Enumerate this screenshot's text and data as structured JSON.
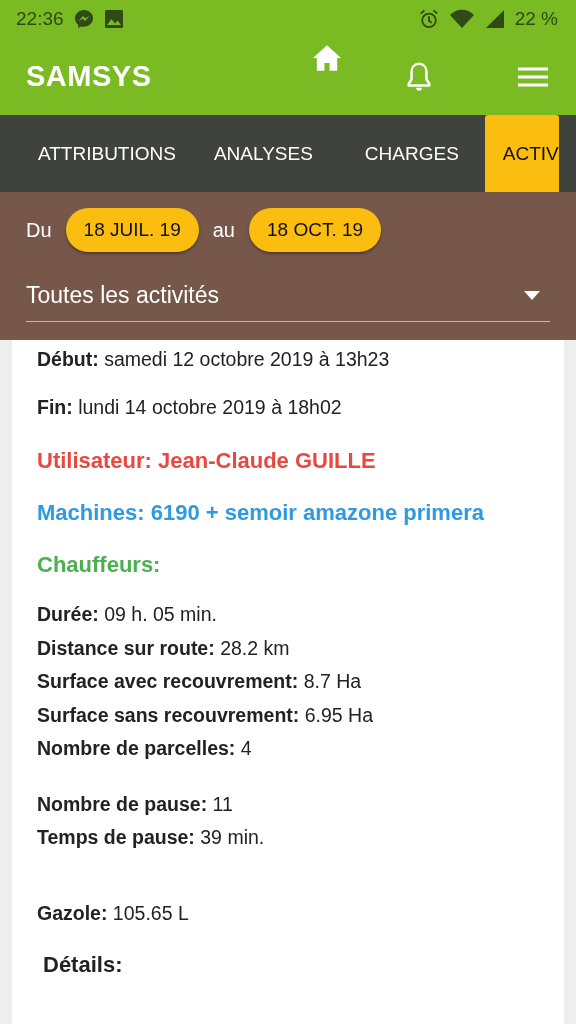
{
  "status_bar": {
    "time": "22:36",
    "battery": "22 %"
  },
  "app_bar": {
    "title": "SAMSYS"
  },
  "tabs": [
    {
      "label": "ATTRIBUTIONS",
      "selected": false
    },
    {
      "label": "ANALYSES",
      "selected": false
    },
    {
      "label": "CHARGES",
      "selected": false
    },
    {
      "label": "ACTIV",
      "selected": true
    }
  ],
  "filter": {
    "from_label": "Du",
    "from_date": "18 JUIL. 19",
    "to_label": "au",
    "to_date": "18 OCT. 19",
    "activity": "Toutes les activités"
  },
  "details": [
    {
      "kind": "line",
      "label": "Début:",
      "value": "samedi 12 octobre 2019 à 13h23"
    },
    {
      "kind": "line",
      "label": "Fin:",
      "value": "lundi 14 octobre 2019 à 18h02"
    },
    {
      "kind": "heading",
      "text": "Utilisateur: Jean-Claude GUILLE",
      "color": "#e8483e"
    },
    {
      "kind": "heading",
      "text": "Machines: 6190 + semoir amazone primera",
      "color": "#2f9ae0"
    },
    {
      "kind": "heading",
      "text": "Chauffeurs:",
      "color": "#4caf50"
    },
    {
      "kind": "group",
      "fields": [
        {
          "label": "Durée:",
          "value": "09 h. 05 min."
        },
        {
          "label": "Distance sur route:",
          "value": "28.2 km"
        },
        {
          "label": "Surface avec recouvrement:",
          "value": "8.7 Ha"
        },
        {
          "label": "Surface sans recouvrement:",
          "value": "6.95 Ha"
        },
        {
          "label": "Nombre de parcelles:",
          "value": "4"
        }
      ]
    },
    {
      "kind": "group",
      "fields": [
        {
          "label": "Nombre de pause:",
          "value": "11"
        },
        {
          "label": "Temps de pause:",
          "value": "39 min."
        }
      ]
    },
    {
      "kind": "group",
      "fields": [
        {
          "label": "Gazole:",
          "value": "105.65 L"
        }
      ]
    },
    {
      "kind": "section",
      "text": "Détails:"
    }
  ]
}
